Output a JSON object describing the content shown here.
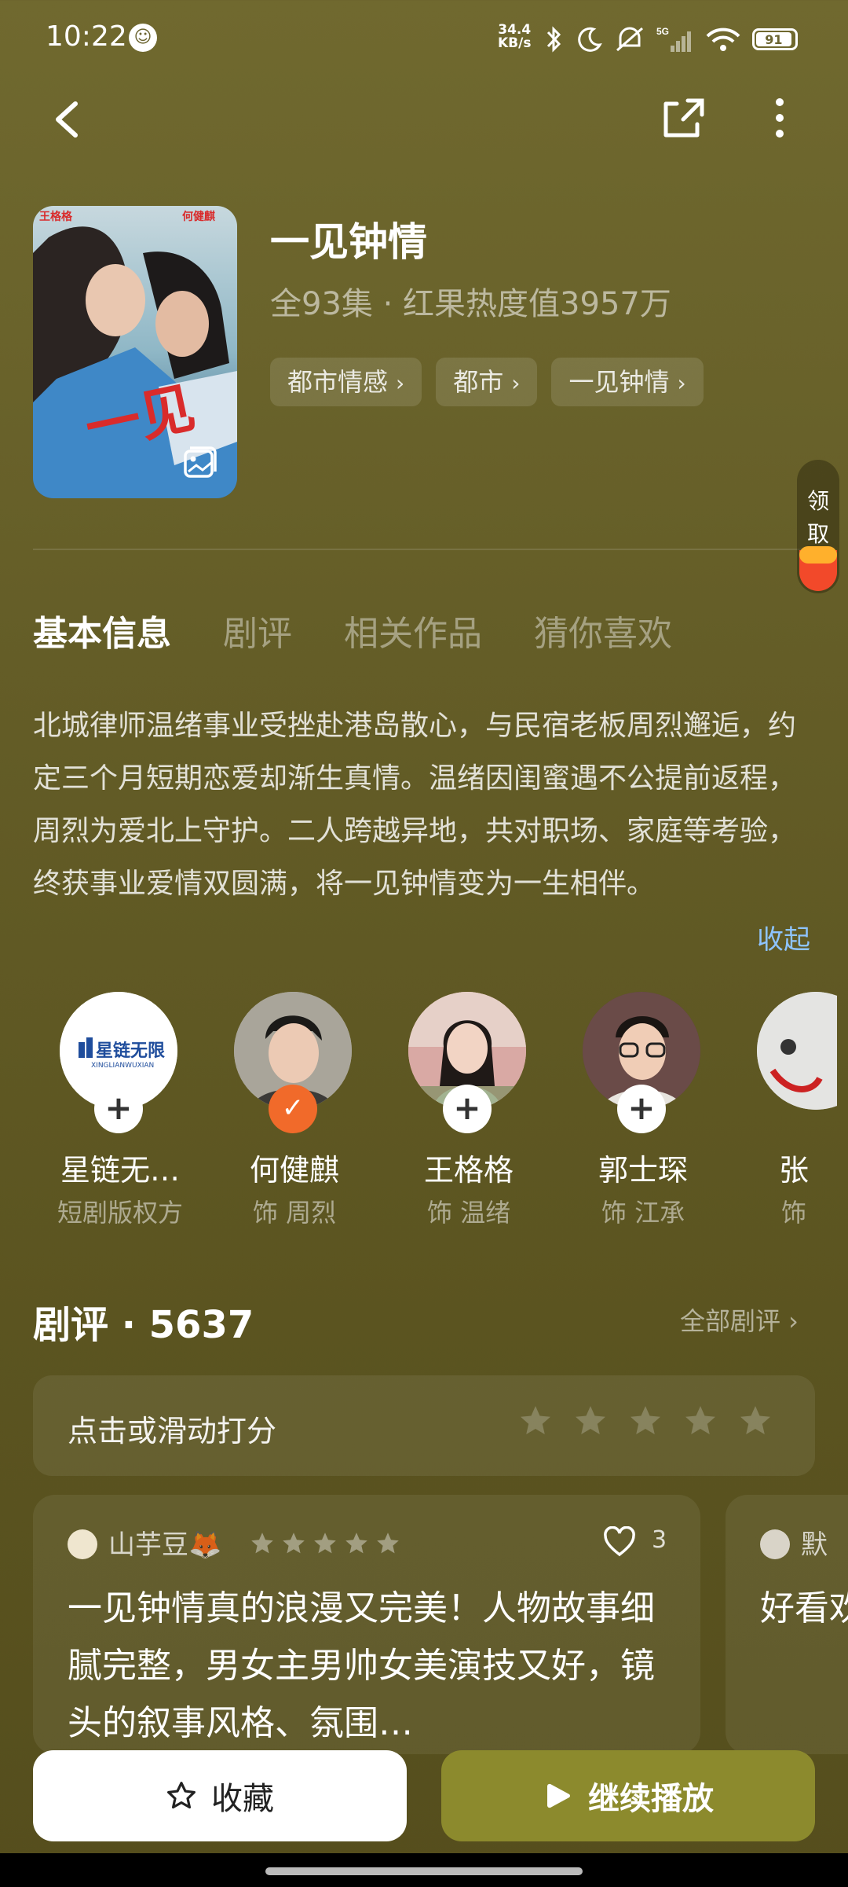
{
  "status": {
    "time": "10:22",
    "net_speed_top": "34.4",
    "net_speed_unit": "KB/s",
    "battery": "91"
  },
  "drama": {
    "title": "一见钟情",
    "meta": "全93集 · 红果热度值3957万",
    "tags": [
      "都市情感",
      "都市",
      "一见钟情"
    ]
  },
  "reward": {
    "label_1": "领",
    "label_2": "取"
  },
  "tabs": [
    "基本信息",
    "剧评",
    "相关作品",
    "猜你喜欢"
  ],
  "synopsis": "北城律师温绪事业受挫赴港岛散心，与民宿老板周烈邂逅，约定三个月短期恋爱却渐生真情。温绪因闺蜜遇不公提前返程，周烈为爱北上守护。二人跨越异地，共对职场、家庭等考验，终获事业爱情双圆满，将一见钟情变为一生相伴。",
  "collapse_label": "收起",
  "cast": [
    {
      "name": "星链无…",
      "role": "短剧版权方",
      "badge": "+"
    },
    {
      "name": "何健麒",
      "role": "饰 周烈",
      "badge": "✓"
    },
    {
      "name": "王格格",
      "role": "饰 温绪",
      "badge": "+"
    },
    {
      "name": "郭士琛",
      "role": "饰 江承",
      "badge": "+"
    },
    {
      "name": "张",
      "role": "饰",
      "badge": ""
    }
  ],
  "reviews": {
    "heading": "剧评 · 5637",
    "all_label": "全部剧评 ›",
    "rate_prompt": "点击或滑动打分",
    "card1": {
      "user": "山芋豆🦊",
      "likes": "3",
      "text": "一见钟情真的浪漫又完美！人物故事细腻完整，男女主男帅女美演技又好，镜头的叙事风格、氛围…"
    },
    "card2": {
      "user": "默",
      "text": "好看欢的有港"
    }
  },
  "bottom": {
    "favorite_label": "收藏",
    "play_label": "继续播放"
  },
  "colors": {
    "background": "#655e28",
    "accent_play": "#8c8a2d",
    "follow_badge": "#f16a2a",
    "collapse_link": "#8ec4ff"
  }
}
